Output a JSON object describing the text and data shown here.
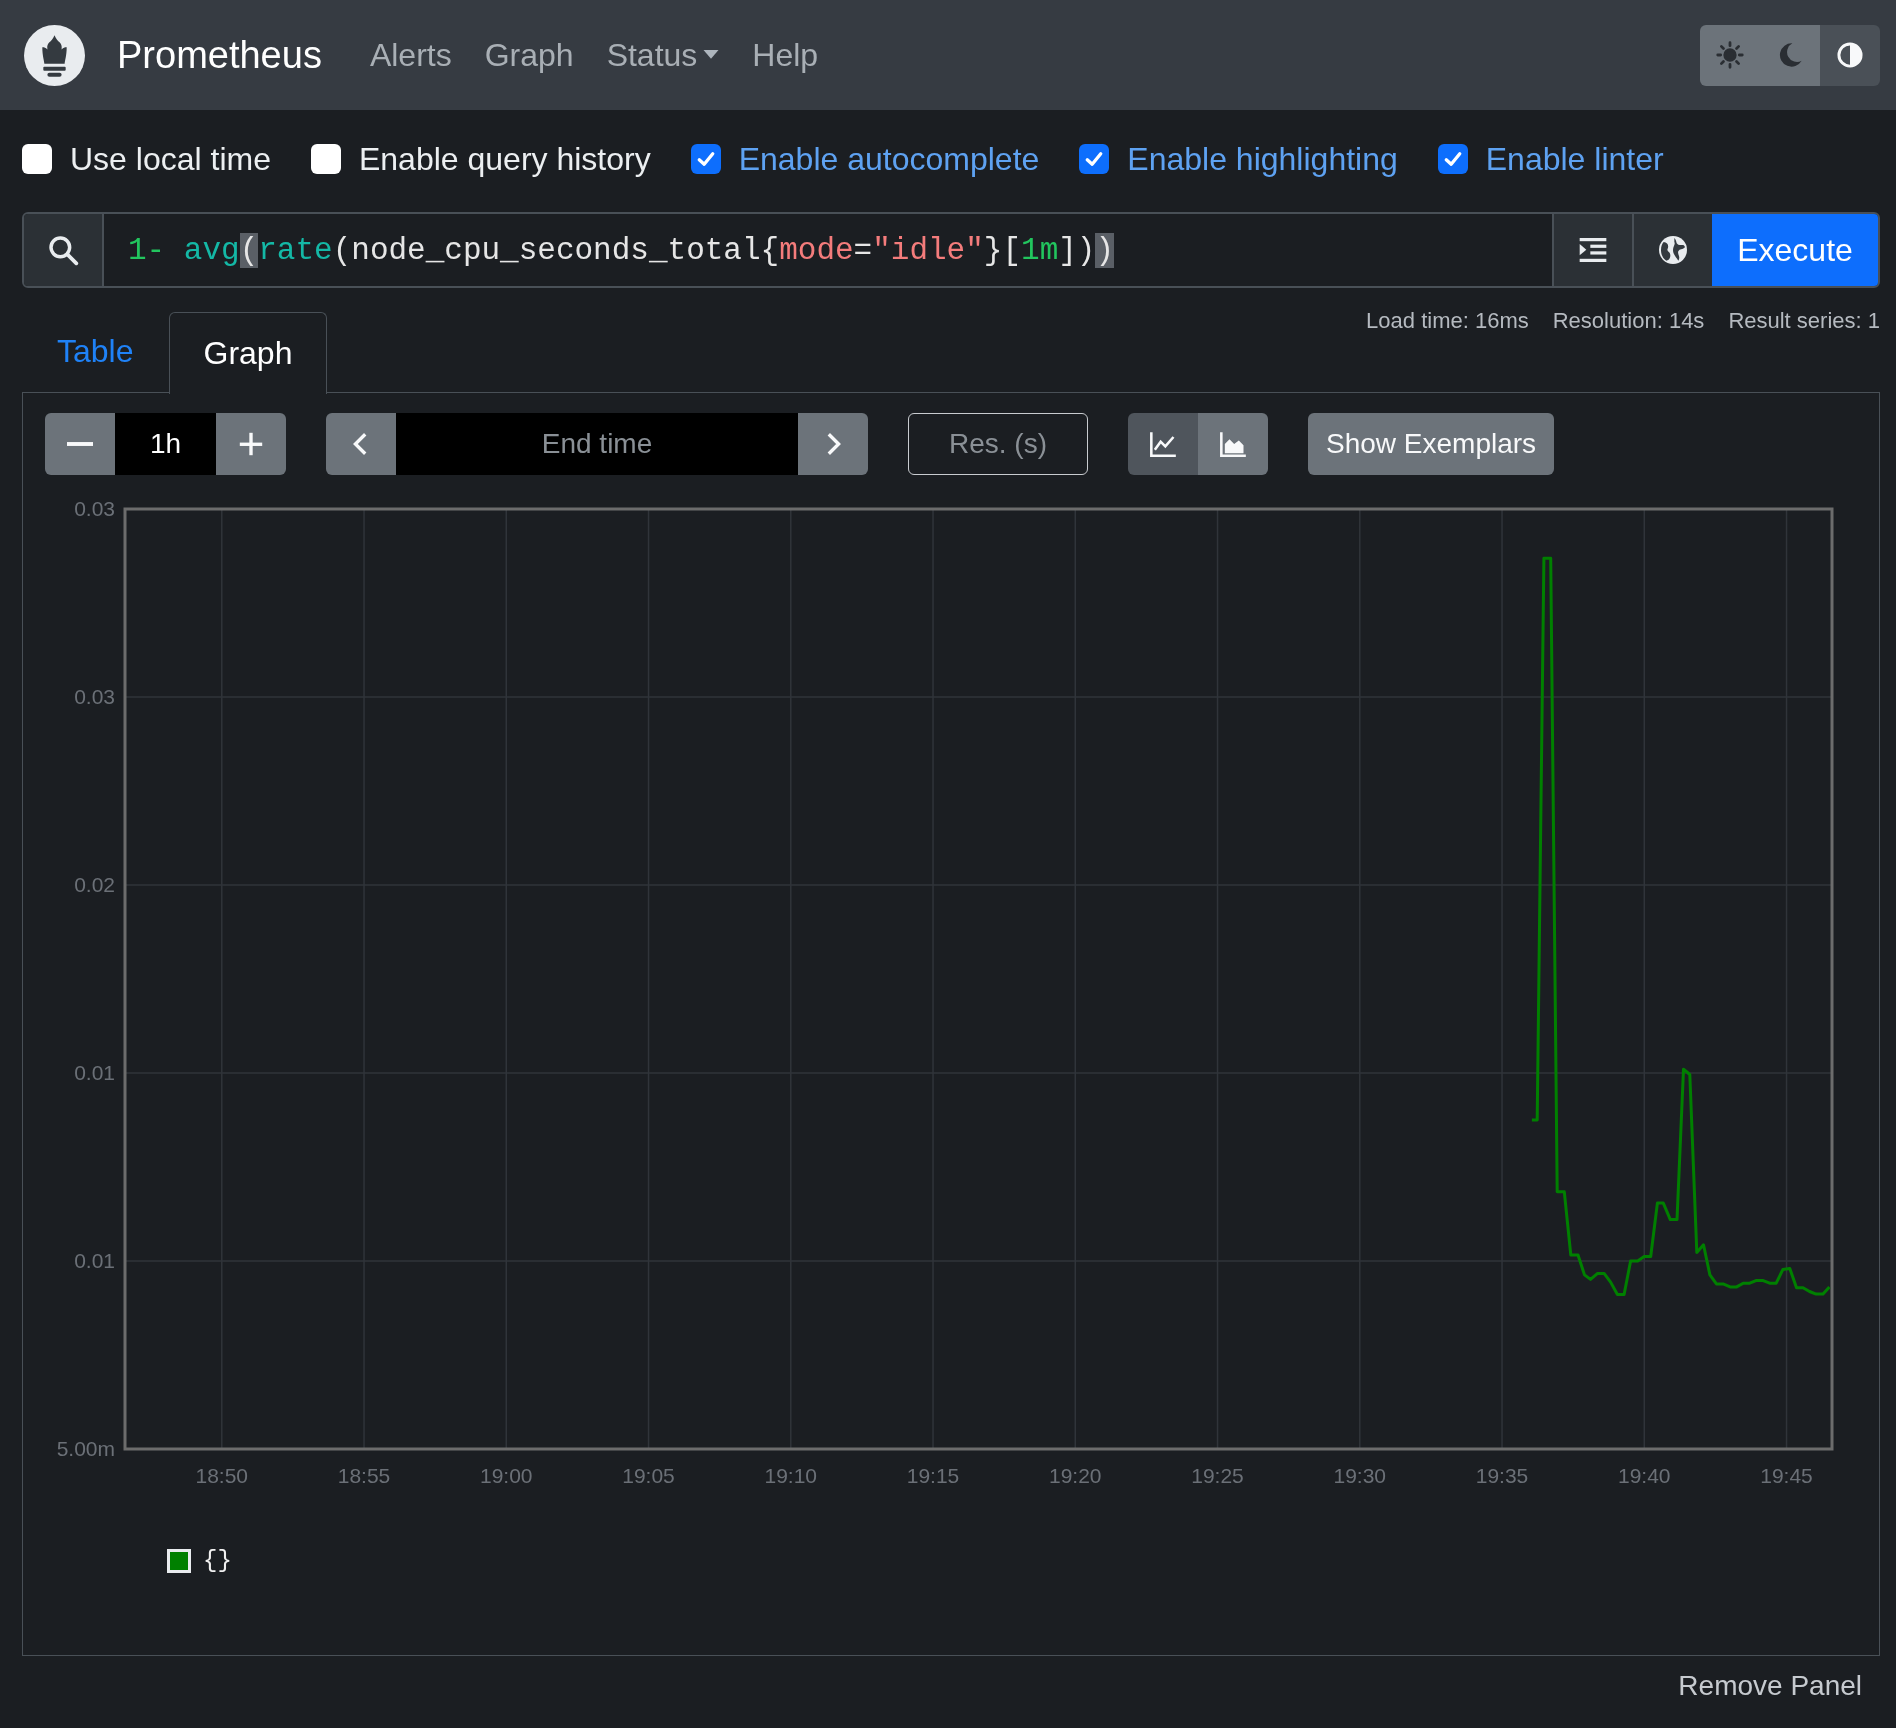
{
  "navbar": {
    "brand": "Prometheus",
    "links": [
      {
        "label": "Alerts",
        "kind": "link"
      },
      {
        "label": "Graph",
        "kind": "link"
      },
      {
        "label": "Status",
        "kind": "dropdown"
      },
      {
        "label": "Help",
        "kind": "link"
      }
    ],
    "theme_buttons": [
      {
        "kind": "light",
        "selected": false
      },
      {
        "kind": "dark",
        "selected": false
      },
      {
        "kind": "auto",
        "selected": true
      }
    ]
  },
  "options": [
    {
      "label": "Use local time",
      "checked": false
    },
    {
      "label": "Enable query history",
      "checked": false
    },
    {
      "label": "Enable autocomplete",
      "checked": true
    },
    {
      "label": "Enable highlighting",
      "checked": true
    },
    {
      "label": "Enable linter",
      "checked": true
    }
  ],
  "query": {
    "tokens": [
      {
        "text": "1",
        "kind": "number",
        "matched": false
      },
      {
        "text": "- ",
        "kind": "operator",
        "matched": false
      },
      {
        "text": "avg",
        "kind": "function",
        "matched": false
      },
      {
        "text": "(",
        "kind": "paren",
        "matched": true
      },
      {
        "text": "rate",
        "kind": "function",
        "matched": false
      },
      {
        "text": "(",
        "kind": "paren",
        "matched": false
      },
      {
        "text": "node_cpu_seconds_total",
        "kind": "metric",
        "matched": false
      },
      {
        "text": "{",
        "kind": "paren",
        "matched": false
      },
      {
        "text": "mode",
        "kind": "label",
        "matched": false
      },
      {
        "text": "=",
        "kind": "paren",
        "matched": false
      },
      {
        "text": "\"idle\"",
        "kind": "string",
        "matched": false
      },
      {
        "text": "}[",
        "kind": "paren",
        "matched": false
      },
      {
        "text": "1m",
        "kind": "number",
        "matched": false
      },
      {
        "text": "])",
        "kind": "paren",
        "matched": false
      },
      {
        "text": ")",
        "kind": "paren",
        "matched": true
      }
    ],
    "execute": "Execute"
  },
  "tabs": [
    {
      "label": "Table",
      "selected": false
    },
    {
      "label": "Graph",
      "selected": true
    }
  ],
  "stats": [
    "Load time: 16ms",
    "Resolution: 14s",
    "Result series: 1"
  ],
  "controls": {
    "range": {
      "value": "1h"
    },
    "end_time": {
      "placeholder": "End time"
    },
    "resolution": {
      "placeholder": "Res. (s)"
    },
    "chart_types": [
      {
        "kind": "line",
        "selected": true
      },
      {
        "kind": "stacked",
        "selected": false
      }
    ],
    "exemplars": "Show Exemplars"
  },
  "graph": {
    "y_axis_labels": [
      "0.03",
      "0.03",
      "0.02",
      "0.01",
      "0.01",
      "5.00m"
    ],
    "x_axis_labels": [
      "18:50",
      "18:55",
      "19:00",
      "19:05",
      "19:10",
      "19:15",
      "19:20",
      "19:25",
      "19:30",
      "19:35",
      "19:40",
      "19:45"
    ],
    "series": [
      {
        "name": "{}",
        "color": "#008000"
      }
    ]
  },
  "remove_panel": "Remove Panel"
}
